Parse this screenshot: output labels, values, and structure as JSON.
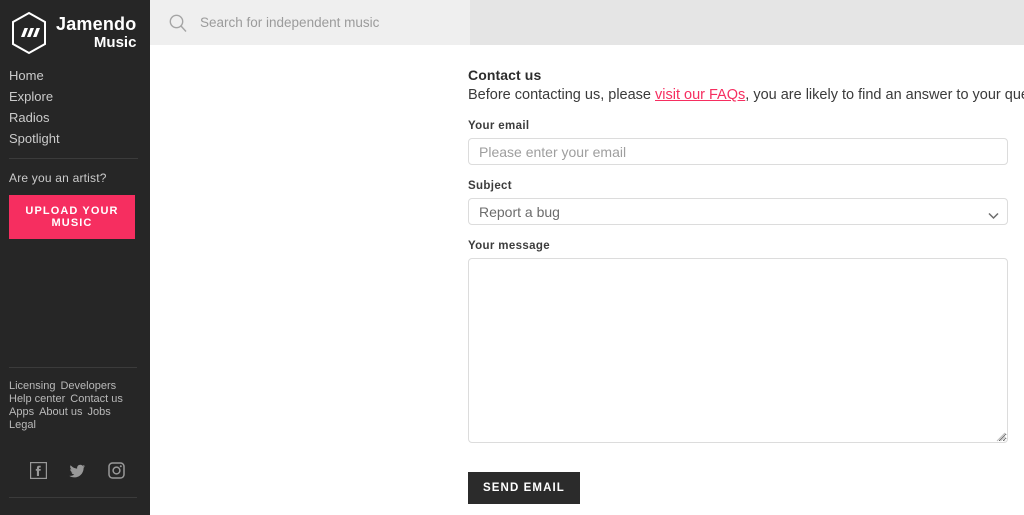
{
  "brand": {
    "name": "Jamendo",
    "subtitle": "Music",
    "logo_icon": "hexagon-soundwave-logo"
  },
  "sidebar": {
    "nav": [
      {
        "label": "Home"
      },
      {
        "label": "Explore"
      },
      {
        "label": "Radios"
      },
      {
        "label": "Spotlight"
      }
    ],
    "artist": {
      "question": "Are you an artist?",
      "upload_label": "UPLOAD YOUR MUSIC",
      "upload_color": "#f62e60"
    },
    "footer_links": [
      {
        "label": "Licensing"
      },
      {
        "label": "Developers"
      },
      {
        "label": "Help center"
      },
      {
        "label": "Contact us"
      },
      {
        "label": "Apps"
      },
      {
        "label": "About us"
      },
      {
        "label": "Jobs"
      },
      {
        "label": "Legal"
      }
    ],
    "socials": [
      {
        "icon": "facebook-icon",
        "name": "Facebook"
      },
      {
        "icon": "twitter-icon",
        "name": "Twitter"
      },
      {
        "icon": "instagram-icon",
        "name": "Instagram"
      }
    ],
    "background_color": "#262626"
  },
  "search": {
    "placeholder": "Search for independent music",
    "value": "",
    "icon": "search-icon"
  },
  "form": {
    "title": "Contact us",
    "intro_before": "Before contacting us, please ",
    "intro_link": "visit our FAQs",
    "intro_after": ", you are likely to find an answer to your question!",
    "link_color": "#f62e60",
    "email": {
      "label": "Your email",
      "placeholder": "Please enter your email",
      "value": ""
    },
    "subject": {
      "label": "Subject",
      "selected": "Report a bug",
      "options": [
        "Report a bug"
      ]
    },
    "message": {
      "label": "Your message",
      "placeholder": "",
      "value": ""
    },
    "submit_label": "SEND EMAIL"
  }
}
